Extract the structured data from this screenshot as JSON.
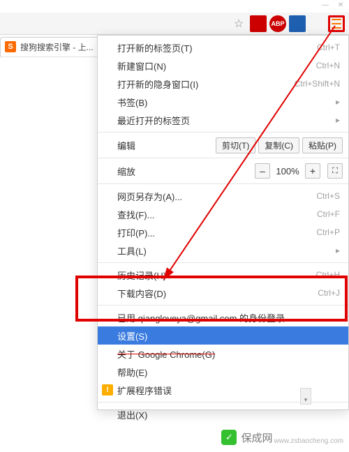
{
  "window_controls": {
    "minimize": "—",
    "close": "✕"
  },
  "toolbar": {
    "star": "☆",
    "ext_abp": "ABP",
    "hamburger_name": "menu"
  },
  "tab": {
    "favicon_letter": "S",
    "title": "搜狗搜索引擎 - 上...",
    "close": "×"
  },
  "menu": {
    "new_tab": "打开新的标签页(T)",
    "new_tab_sc": "Ctrl+T",
    "new_window": "新建窗口(N)",
    "new_window_sc": "Ctrl+N",
    "new_incognito": "打开新的隐身窗口(I)",
    "new_incognito_sc": "Ctrl+Shift+N",
    "bookmarks": "书签(B)",
    "recent_tabs": "最近打开的标签页",
    "edit_label": "编辑",
    "cut": "剪切(T)",
    "copy": "复制(C)",
    "paste": "粘贴(P)",
    "zoom_label": "缩放",
    "zoom_value": "100%",
    "save_as": "网页另存为(A)...",
    "save_as_sc": "Ctrl+S",
    "find": "查找(F)...",
    "find_sc": "Ctrl+F",
    "print": "打印(P)...",
    "print_sc": "Ctrl+P",
    "tools": "工具(L)",
    "history": "历史记录(H)",
    "history_sc": "Ctrl+H",
    "downloads": "下载内容(D)",
    "downloads_sc": "Ctrl+J",
    "signed_in": "已用 qiangloveya@gmail.com 的身份登录...",
    "settings": "设置(S)",
    "about": "关于 Google Chrome(G)",
    "help": "帮助(E)",
    "ext_error": "扩展程序错误",
    "exit": "退出(X)"
  },
  "watermark": {
    "main": "保成网",
    "sub": "www.zsbaocheng.com"
  }
}
